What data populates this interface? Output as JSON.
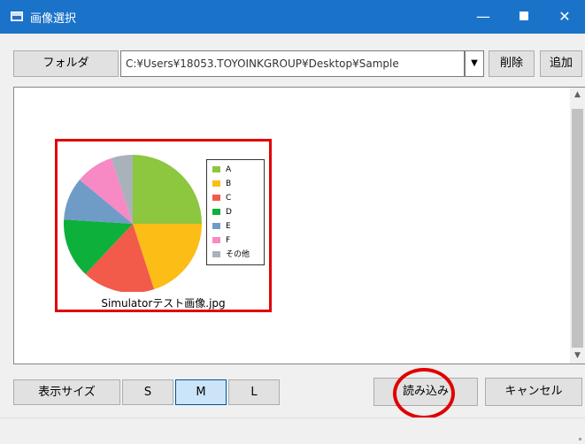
{
  "window": {
    "title": "画像選択"
  },
  "toolbar": {
    "folder_label": "フォルダ",
    "path_value": "C:¥Users¥18053.TOYOINKGROUP¥Desktop¥Sample",
    "dropdown_glyph": "▼",
    "delete_label": "削除",
    "add_label": "追加"
  },
  "gallery": {
    "items": [
      {
        "caption": "Simulatorテスト画像.jpg",
        "selected": true,
        "chart_data": {
          "type": "pie",
          "series": [
            {
              "label": "A",
              "value": 25,
              "color": "#8dc63f"
            },
            {
              "label": "B",
              "value": 20,
              "color": "#fbbd16"
            },
            {
              "label": "C",
              "value": 17,
              "color": "#f25a4a"
            },
            {
              "label": "D",
              "value": 14,
              "color": "#0eb03c"
            },
            {
              "label": "E",
              "value": 10,
              "color": "#6f9cc6"
            },
            {
              "label": "F",
              "value": 9,
              "color": "#f789c4"
            },
            {
              "label": "その他",
              "value": 5,
              "color": "#a9b2bb"
            }
          ]
        }
      }
    ]
  },
  "bottom": {
    "size_label": "表示サイズ",
    "size_s": "S",
    "size_m": "M",
    "size_l": "L",
    "selected_size": "M",
    "load_label": "読み込み",
    "cancel_label": "キャンセル"
  },
  "annotation": {
    "color": "#e00000"
  }
}
